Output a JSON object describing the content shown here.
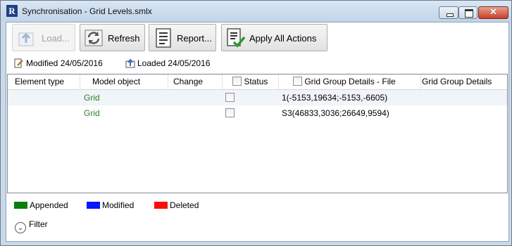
{
  "window": {
    "title": "Synchronisation - Grid Levels.smlx",
    "app_icon_letter": "R",
    "controls": {
      "minimize": "minimize-icon",
      "maximize": "maximize-icon",
      "close": "close-icon",
      "close_glyph": "✕"
    }
  },
  "toolbar": {
    "load_label": "Load...",
    "refresh_label": "Refresh",
    "report_label": "Report...",
    "apply_all_label": "Apply All Actions"
  },
  "info": {
    "modified": "Modified 24/05/2016",
    "loaded": "Loaded 24/05/2016"
  },
  "grid": {
    "columns": [
      "Element type",
      "Model object",
      "Change",
      "Status",
      "Grid Group Details - File",
      "Grid Group Details"
    ],
    "rows": [
      {
        "element_type": "",
        "model_object": "Grid",
        "change": "",
        "status_checked": false,
        "file_details": "1(-5153,19634;-5153,-6605)",
        "details": ""
      },
      {
        "element_type": "",
        "model_object": "Grid",
        "change": "",
        "status_checked": false,
        "file_details": "S3(46833,3036;26649,9594)",
        "details": ""
      }
    ]
  },
  "legend": [
    {
      "label": "Appended",
      "color": "#0a7d0a"
    },
    {
      "label": "Modified",
      "color": "#0a14ff"
    },
    {
      "label": "Deleted",
      "color": "#ff0a0a"
    }
  ],
  "filter": {
    "label": "Filter",
    "icon": "chevron-down-icon"
  }
}
